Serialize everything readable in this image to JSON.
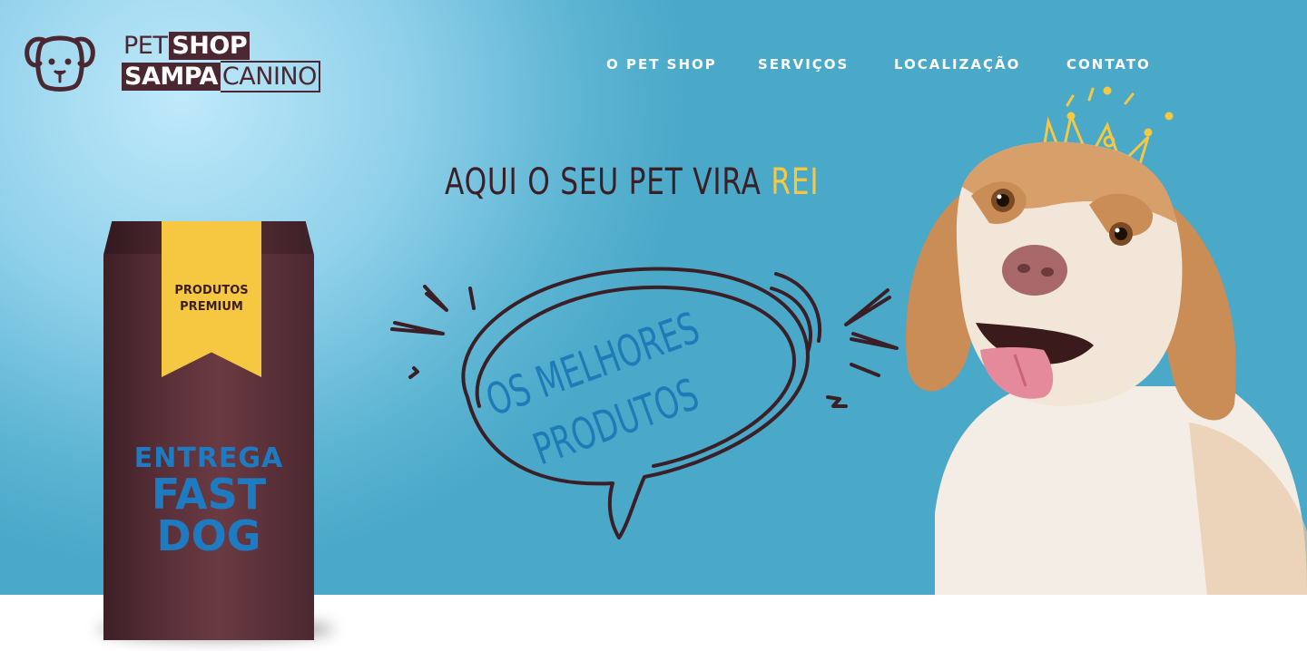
{
  "logo": {
    "line1_part1": "PET",
    "line1_part2": "SHOP",
    "line2_part1": "SAMPA",
    "line2_part2": "CANINO"
  },
  "nav": {
    "items": [
      {
        "label": "O PET SHOP"
      },
      {
        "label": "SERVIÇOS"
      },
      {
        "label": "LOCALIZAÇÃO"
      },
      {
        "label": "CONTATO"
      }
    ]
  },
  "hero": {
    "headline_main": "AQUI O SEU PET VIRA ",
    "headline_accent": "REI",
    "bubble_line1": "OS MELHORES",
    "bubble_line2": "PRODUTOS"
  },
  "product": {
    "ribbon_line1": "PRODUTOS",
    "ribbon_line2": "PREMIUM",
    "delivery_line1": "ENTREGA",
    "delivery_line2": "FAST",
    "delivery_line3": "DOG"
  },
  "colors": {
    "brand_dark": "#4b2731",
    "accent_yellow": "#f5c842",
    "accent_blue": "#1e7bb8",
    "sky": "#4aa8c8"
  }
}
